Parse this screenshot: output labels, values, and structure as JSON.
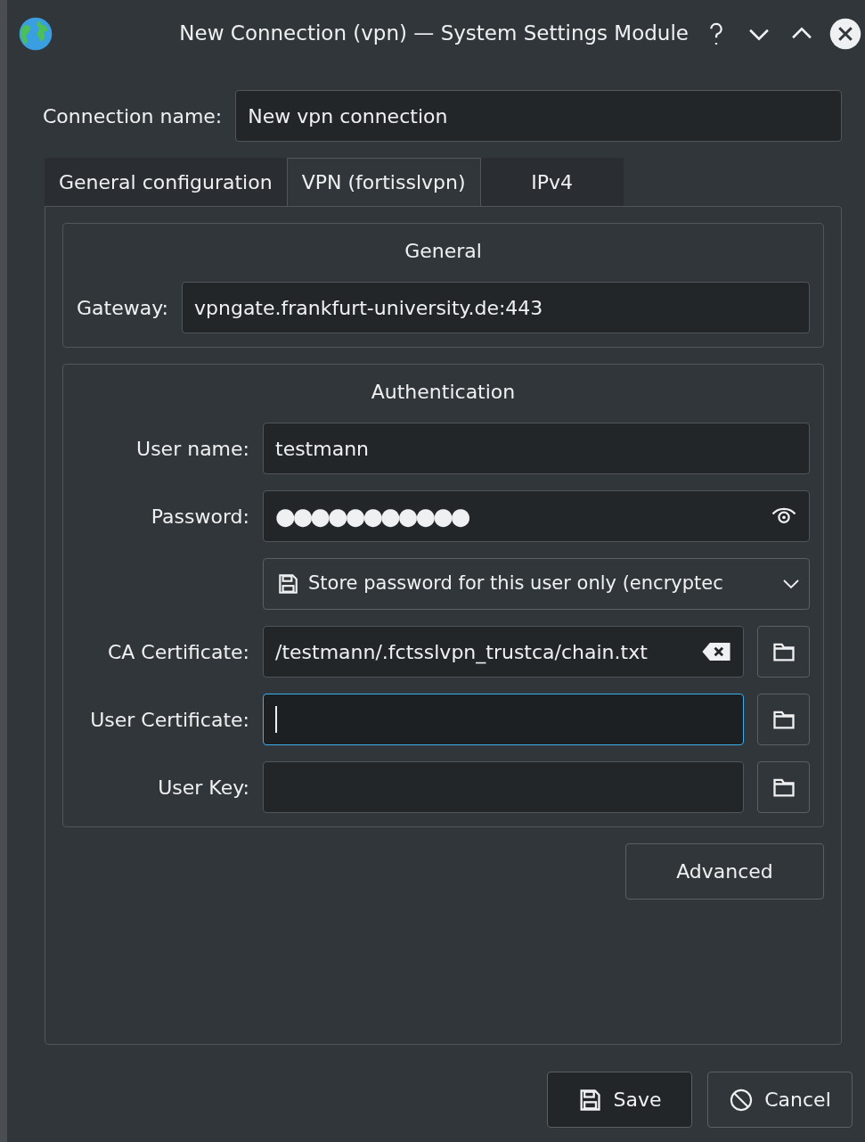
{
  "window": {
    "title": "New Connection (vpn) — System Settings Module"
  },
  "connection_name": {
    "label": "Connection name:",
    "value": "New vpn connection"
  },
  "tabs": [
    {
      "label": "General configuration",
      "selected": false
    },
    {
      "label": "VPN (fortisslvpn)",
      "selected": true
    },
    {
      "label": "IPv4",
      "selected": false
    }
  ],
  "general": {
    "title": "General",
    "gateway": {
      "label": "Gateway:",
      "value": "vpngate.frankfurt-university.de:443"
    }
  },
  "authentication": {
    "title": "Authentication",
    "fields": [
      {
        "kind": "text",
        "label": "User name:",
        "value": "testmann",
        "focused": false
      },
      {
        "kind": "password",
        "label": "Password:",
        "value": "●●●●●●●●●●●",
        "focused": false
      },
      {
        "kind": "combo",
        "value": "Store password for this user only (encryptec"
      },
      {
        "kind": "file",
        "label": "CA Certificate:",
        "value": "/testmann/.fctsslvpn_trustca/chain.txt",
        "focused": false
      },
      {
        "kind": "file",
        "label": "User Certificate:",
        "focused": true
      },
      {
        "kind": "file",
        "label": "User Key:",
        "focused": false
      }
    ]
  },
  "advanced_button": "Advanced",
  "buttons": [
    {
      "kind": "save",
      "label": "Save"
    },
    {
      "kind": "cancel",
      "label": "Cancel"
    }
  ]
}
